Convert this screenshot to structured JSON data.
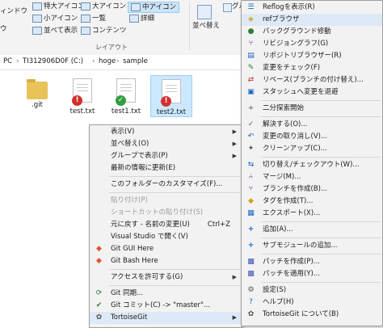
{
  "ribbon": {
    "left_labels": [
      "ィンドウ",
      "ウ"
    ],
    "layout_options": [
      {
        "label": "特大アイコン",
        "active": false
      },
      {
        "label": "大アイコン",
        "active": false
      },
      {
        "label": "中アイコン",
        "active": true
      },
      {
        "label": "小アイコン",
        "active": false
      },
      {
        "label": "一覧",
        "active": false
      },
      {
        "label": "詳細",
        "active": false
      },
      {
        "label": "並べて表示",
        "active": false
      },
      {
        "label": "コンテンツ",
        "active": false
      }
    ],
    "layout_caption": "レイアウト",
    "sort_label": "並べ替え",
    "group_label": "グル"
  },
  "address": {
    "segments": [
      "PC",
      "TI312906D0F (C:)",
      "hoge",
      "sample"
    ]
  },
  "files": [
    {
      "name": ".git",
      "type": "folder",
      "status": ""
    },
    {
      "name": "test.txt",
      "type": "doc",
      "status": "modified"
    },
    {
      "name": "test1.txt",
      "type": "doc",
      "status": "ok"
    },
    {
      "name": "test2.txt",
      "type": "doc",
      "status": "modified"
    }
  ],
  "context_menu": {
    "view": "表示(V)",
    "sort": "並べ替え(O)",
    "group": "グループで表示(P)",
    "refresh": "最新の情報に更新(E)",
    "customize": "このフォルダーのカスタマイズ(F)...",
    "paste": "貼り付け(P)",
    "paste_shortcut": "ショートカットの貼り付け(S)",
    "undo_rename": "元に戻す - 名前の変更(U)",
    "undo_shortcut": "Ctrl+Z",
    "vs": "Visual Studio で開く(V)",
    "git_gui": "Git GUI Here",
    "git_bash": "Git Bash Here",
    "access": "アクセスを許可する(G)",
    "git_sync": "Git 同期...",
    "git_commit": "Git コミット(C) -> \"master\"...",
    "tortoise": "TortoiseGit"
  },
  "submenu": {
    "items": [
      "Reflogを表示(R)",
      "refブラウザ",
      "バックグラウンド修動",
      "リビジョングラフ(G)",
      "リポジトリブラウザー(R)",
      "変更をチェック(F)",
      "リベース(ブランチの付け替え)...",
      "スタッシュへ変更を退避",
      "二分探索開始",
      "解決する(O)...",
      "変更の取り消し(V)...",
      "クリーンアップ(C)...",
      "切り替え/チェックアウト(W)...",
      "マージ(M)...",
      "ブランチを作成(B)...",
      "タグを作成(T)...",
      "エクスポート(X)...",
      "追加(A)...",
      "サブモジュールの追加...",
      "パッチを作成(P)...",
      "パッチを適用(Y)...",
      "設定(S)",
      "ヘルプ(H)",
      "TortoiseGit について(B)"
    ]
  },
  "colors": {
    "modified": "#d32f2f",
    "ok": "#2e9e3e",
    "folder": "#e8c35a",
    "selection": "#cce8ff",
    "menu_bg": "#f2f2f2"
  }
}
